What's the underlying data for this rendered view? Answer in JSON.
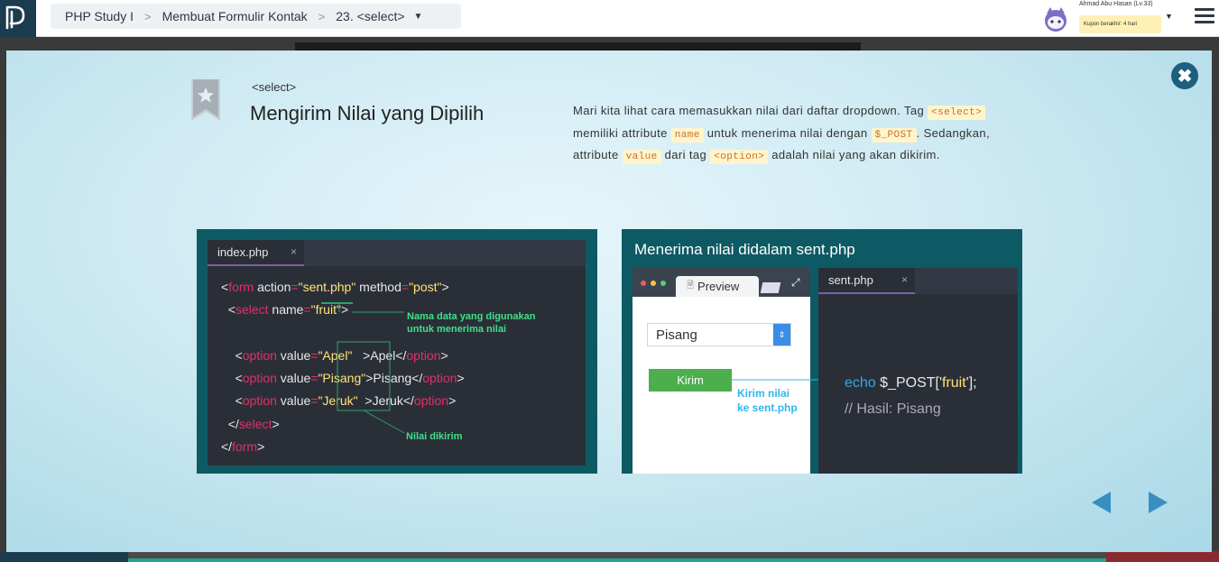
{
  "breadcrumb": {
    "items": [
      "PHP Study I",
      "Membuat Formulir Kontak",
      "23. <select>"
    ]
  },
  "user": {
    "name": "Ahmad Abu Hasan (Lv.33)",
    "coupon": "Kupon berakhir: 4 hari"
  },
  "slide": {
    "tagline": "<select>",
    "title": "Mengirim Nilai yang Dipilih",
    "desc": {
      "p1": "Mari kita lihat cara memasukkan nilai dari daftar dropdown. Tag ",
      "c1": "<select>",
      "p2": " memiliki attribute ",
      "c2": "name",
      "p3": " untuk menerima nilai dengan ",
      "c3": "$_POST",
      "p4": ". Sedangkan, attribute ",
      "c4": "value",
      "p5": " dari tag ",
      "c5": "<option>",
      "p6": " adalah nilai yang akan dikirim."
    }
  },
  "left_panel": {
    "tab": "index.php",
    "code": {
      "form_open_1": "<",
      "form_kw": "form",
      "form_rest_a": " action",
      "form_eq_a": "=",
      "form_action": "\"sent.php\"",
      "form_rest_b": " method",
      "form_eq_b": "=",
      "form_method": "\"post\"",
      "form_close": ">",
      "select_lt": "<",
      "select_kw": "select",
      "select_name": " name",
      "select_eq": "=",
      "select_val": "\"fruit\"",
      "select_gt": ">",
      "options": [
        {
          "lt": "<",
          "kw": "option",
          "attr": " value",
          "eq": "=",
          "val": "\"Apel\"",
          "text": ">Apel</",
          "kw2": "option",
          "gt": ">"
        },
        {
          "lt": "<",
          "kw": "option",
          "attr": " value",
          "eq": "=",
          "val": "\"Pisang\"",
          "text": ">Pisang</",
          "kw2": "option",
          "gt": ">"
        },
        {
          "lt": "<",
          "kw": "option",
          "attr": " value",
          "eq": "=",
          "val": "\"Jeruk\"",
          "text": ">Jeruk</",
          "kw2": "option",
          "gt": ">"
        }
      ],
      "select_end_lt": "</",
      "select_end_kw": "select",
      "select_end_gt": ">",
      "form_end_lt": "</",
      "form_end_kw": "form",
      "form_end_gt": ">"
    },
    "annotation_name_1": "Nama data yang digunakan",
    "annotation_name_2": "untuk menerima nilai",
    "annotation_sent": "Nilai dikirim"
  },
  "right_panel": {
    "title": "Menerima nilai didalam sent.php",
    "preview_tab": "Preview",
    "select_value": "Pisang",
    "button": "Kirim",
    "annotation_1": "Kirim nilai",
    "annotation_2": "ke sent.php",
    "tab": "sent.php",
    "echo_kw": "echo",
    "echo_rest": " $_POST[",
    "echo_str": "'fruit'",
    "echo_end": "];",
    "comment": "// Hasil: Pisang"
  },
  "colors": {
    "accent": "#1d5f7e",
    "panel_bg": "#0e5a64",
    "keyword": "#e0306a",
    "string": "#ffe37a",
    "annotation_green": "#40e08a",
    "annotation_blue": "#2fb6ee"
  }
}
